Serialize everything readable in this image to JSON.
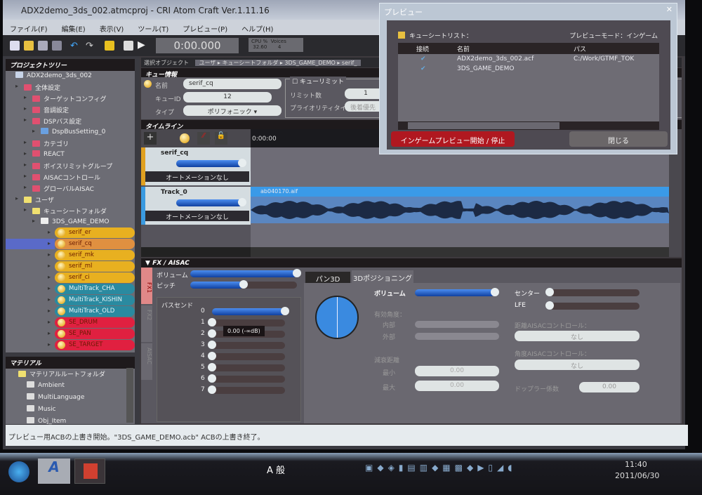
{
  "window": {
    "title": "ADX2demo_3ds_002.atmcproj - CRI Atom Craft Ver.1.11.16"
  },
  "menu": [
    "ファイル(F)",
    "編集(E)",
    "表示(V)",
    "ツール(T)",
    "プレビュー(P)",
    "ヘルプ(H)"
  ],
  "toolbar": {
    "time": "0:00.000",
    "cpu_label": "CPU %",
    "cpu_value": "32.60",
    "voices_label": "Voices",
    "voices_value": "4"
  },
  "project_tree": {
    "title": "プロジェクトツリー",
    "items": [
      {
        "label": "ADX2demo_3ds_002",
        "indent": 0,
        "type": "project"
      },
      {
        "label": "全体設定",
        "indent": 1,
        "type": "red"
      },
      {
        "label": "ターゲットコンフィグ",
        "indent": 2,
        "type": "red"
      },
      {
        "label": "音調設定",
        "indent": 2,
        "type": "red"
      },
      {
        "label": "DSPバス設定",
        "indent": 2,
        "type": "red"
      },
      {
        "label": "DspBusSetting_0",
        "indent": 3,
        "type": "dsp"
      },
      {
        "label": "カテゴリ",
        "indent": 2,
        "type": "red"
      },
      {
        "label": "REACT",
        "indent": 2,
        "type": "red"
      },
      {
        "label": "ボイスリミットグループ",
        "indent": 2,
        "type": "red"
      },
      {
        "label": "AISACコントロール",
        "indent": 2,
        "type": "red"
      },
      {
        "label": "グローバルAISAC",
        "indent": 2,
        "type": "red"
      },
      {
        "label": "ユーザ",
        "indent": 1,
        "type": "yellow"
      },
      {
        "label": "キューシートフォルダ",
        "indent": 2,
        "type": "yellow"
      },
      {
        "label": "3DS_GAME_DEMO",
        "indent": 3,
        "type": "sheet"
      }
    ],
    "cues": [
      {
        "label": "serif_er",
        "color": "#e8b020"
      },
      {
        "label": "serif_cq",
        "color": "#e09040",
        "selected": true
      },
      {
        "label": "serif_mk",
        "color": "#e8b020"
      },
      {
        "label": "serif_ml",
        "color": "#e8b020"
      },
      {
        "label": "serif_ci",
        "color": "#e8b020"
      },
      {
        "label": "MultiTrack_CHA",
        "color": "#2a8aa0"
      },
      {
        "label": "MultiTrack_KISHIN",
        "color": "#2a8aa0"
      },
      {
        "label": "MultiTrack_OLD",
        "color": "#2a8aa0"
      },
      {
        "label": "SE_DRUM",
        "color": "#e02040"
      },
      {
        "label": "SE_PAN",
        "color": "#e02040"
      },
      {
        "label": "SE_TARGET",
        "color": "#e02040"
      }
    ]
  },
  "material": {
    "title": "マテリアル",
    "items": [
      "マテリアルルートフォルダ",
      "Ambient",
      "MultiLanguage",
      "Music",
      "Obj_Item"
    ]
  },
  "breadcrumb": {
    "label": "選択オブジェクト",
    "path": "ユーザ ▸ キューシートフォルダ ▸ 3DS_GAME_DEMO ▸ serif_"
  },
  "cue_info": {
    "title": "キュー情報",
    "name_label": "名前",
    "name": "serif_cq",
    "id_label": "キューID",
    "id": "12",
    "type_label": "タイプ",
    "type": "ポリフォニック",
    "limit_title": "キューリミット",
    "limit_label": "リミット数",
    "limit": "1",
    "priority_label": "プライオリティタイプ",
    "priority": "後着優先"
  },
  "timeline": {
    "title": "タイムライン",
    "time": "0:00:00",
    "tracks": [
      {
        "name": "serif_cq",
        "automation": "オートメーションなし",
        "color": "#e0a020"
      },
      {
        "name": "Track_0",
        "automation": "オートメーションなし",
        "color": "#3a9ae0",
        "clip": "ab040170.aif"
      }
    ]
  },
  "fx": {
    "title": "FX / AISAC",
    "tabs": [
      "FX1",
      "FX2",
      "AISAC"
    ],
    "volume_label": "ボリューム",
    "volume": 1.0,
    "pitch_label": "ピッチ",
    "pitch": 0.5,
    "bus_send_label": "バスセンド",
    "bus_sends": [
      {
        "n": "0",
        "v": 1.0
      },
      {
        "n": "1",
        "v": 0
      },
      {
        "n": "2",
        "v": 0
      },
      {
        "n": "3",
        "v": 0
      },
      {
        "n": "4",
        "v": 0
      },
      {
        "n": "5",
        "v": 0
      },
      {
        "n": "6",
        "v": 0
      },
      {
        "n": "7",
        "v": 0
      }
    ],
    "tooltip": "0.00 (-∞dB)",
    "pan_tabs": [
      "パン3D",
      "3Dポジショニング"
    ],
    "pos": {
      "volume_label": "ボリューム",
      "volume": 1.0,
      "angle_label": "有効角度：",
      "inner_label": "内部",
      "outer_label": "外部",
      "atten_label": "減衰距離",
      "min_label": "最小",
      "min": "0.00",
      "max_label": "最大",
      "max": "0.00",
      "center_label": "センター",
      "center": 0,
      "lfe_label": "LFE",
      "lfe": 0,
      "dist_aisac_label": "距離AISACコントロール：",
      "dist_aisac": "なし",
      "angle_aisac_label": "角度AISACコントロール：",
      "angle_aisac": "なし",
      "doppler_label": "ドップラー係数",
      "doppler": "0.00"
    }
  },
  "status": "プレビュー用ACBの上書き開始。\"3DS_GAME_DEMO.acb\" ACBの上書き終了。",
  "dialog": {
    "title": "プレビュー",
    "list_label": "キューシートリスト：",
    "mode": "プレビューモード：インゲーム",
    "columns": [
      "接続",
      "名前",
      "パス"
    ],
    "rows": [
      {
        "name": "ADX2demo_3ds_002.acf",
        "path": "C:/Work/GTMF_TOK"
      },
      {
        "name": "3DS_GAME_DEMO",
        "path": ""
      }
    ],
    "start_button": "インゲームプレビュー開始 / 停止",
    "close_button": "閉じる"
  },
  "taskbar": {
    "ime": "A 般",
    "time": "11:40",
    "date": "2011/06/30"
  }
}
